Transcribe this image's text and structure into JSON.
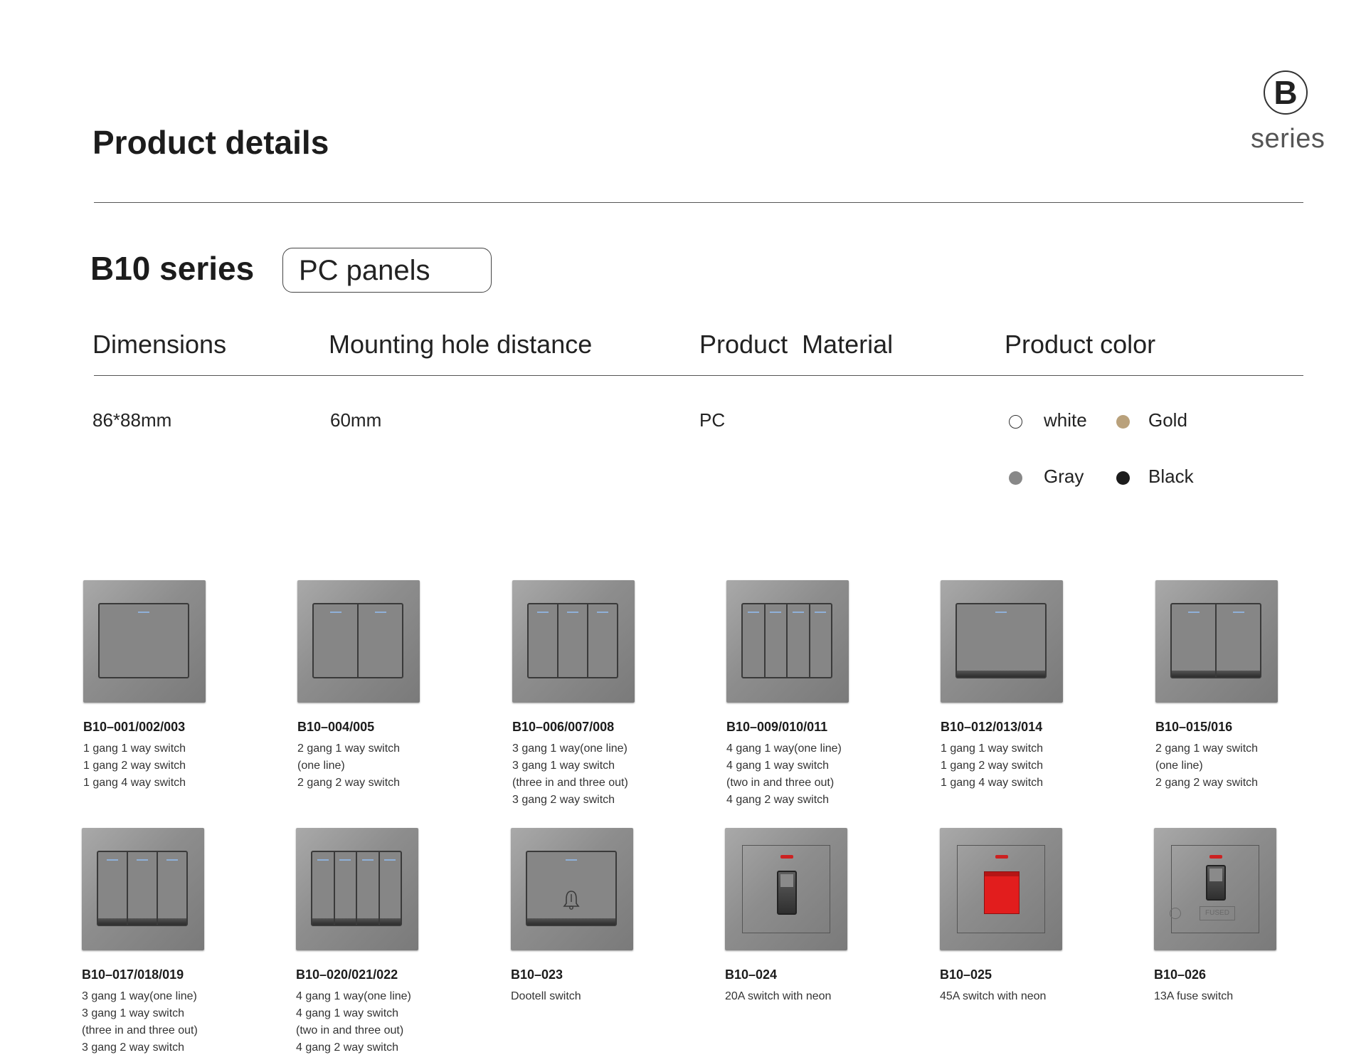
{
  "brand": {
    "letter": "B",
    "word": "series"
  },
  "page_title": "Product details",
  "series": {
    "title": "B10 series",
    "tag": "PC panels"
  },
  "specs": {
    "headers": [
      "Dimensions",
      "Mounting hole distance",
      "Product  Material",
      "Product color"
    ],
    "values": [
      "86*88mm",
      "60mm",
      "PC"
    ]
  },
  "colors": [
    {
      "label": "white",
      "hex": "#ffffff"
    },
    {
      "label": "Gold",
      "hex": "#b9a17b"
    },
    {
      "label": "Gray",
      "hex": "#888888"
    },
    {
      "label": "Black",
      "hex": "#1c1c1c"
    }
  ],
  "products": [
    {
      "model": "B10–001/002/003",
      "lines": [
        "1 gang 1 way switch",
        "1 gang 2 way switch",
        "1 gang 4 way switch"
      ]
    },
    {
      "model": "B10–004/005",
      "lines": [
        "2 gang 1 way switch",
        "(one line)",
        "2 gang 2 way switch"
      ]
    },
    {
      "model": "B10–006/007/008",
      "lines": [
        "3 gang 1 way(one line)",
        "3 gang 1 way switch",
        "(three in and three out)",
        "3 gang 2 way switch"
      ]
    },
    {
      "model": "B10–009/010/011",
      "lines": [
        "4 gang 1 way(one line)",
        "4 gang 1 way switch",
        "(two in and three out)",
        "4 gang 2 way switch"
      ]
    },
    {
      "model": "B10–012/013/014",
      "lines": [
        "1 gang 1 way switch",
        "1 gang 2 way switch",
        "1 gang 4 way switch"
      ]
    },
    {
      "model": "B10–015/016",
      "lines": [
        "2 gang 1 way switch",
        "(one line)",
        "2 gang 2 way switch"
      ]
    },
    {
      "model": "B10–017/018/019",
      "lines": [
        "3 gang 1 way(one line)",
        "3 gang 1 way switch",
        "(three in and three out)",
        "3 gang 2 way switch"
      ]
    },
    {
      "model": "B10–020/021/022",
      "lines": [
        "4 gang 1 way(one line)",
        "4 gang 1 way switch",
        "(two in and three out)",
        "4 gang 2 way switch"
      ]
    },
    {
      "model": "B10–023",
      "lines": [
        "Dootell switch"
      ]
    },
    {
      "model": "B10–024",
      "lines": [
        "20A switch with neon"
      ]
    },
    {
      "model": "B10–025",
      "lines": [
        "45A switch with neon"
      ]
    },
    {
      "model": "B10–026",
      "lines": [
        "13A fuse switch"
      ],
      "fuse_label": "FUSED"
    }
  ]
}
